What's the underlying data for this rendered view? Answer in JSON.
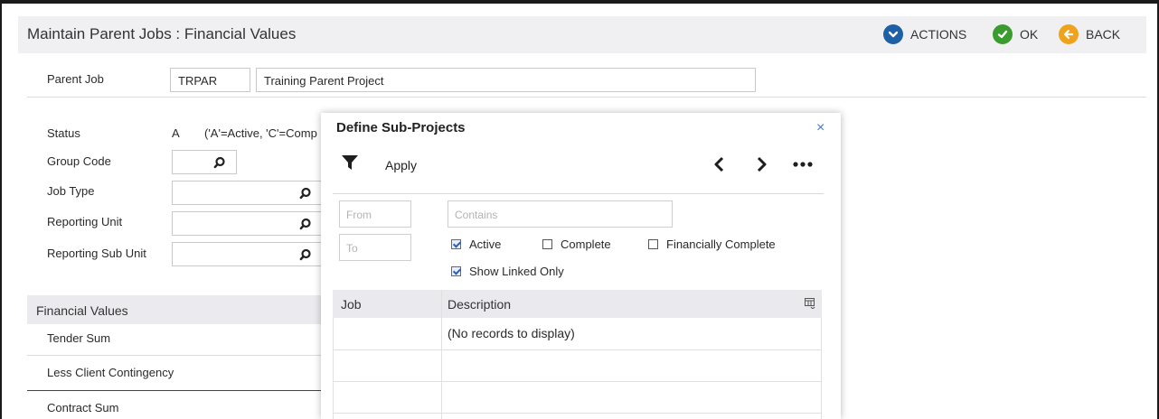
{
  "header": {
    "title": "Maintain Parent Jobs : Financial Values",
    "actions_label": "ACTIONS",
    "ok_label": "OK",
    "back_label": "BACK"
  },
  "colors": {
    "actions": "#1f5fa6",
    "ok": "#3a9b2e",
    "back": "#f0a21c",
    "accent": "#3b7bd4"
  },
  "form": {
    "parent_job_label": "Parent Job",
    "parent_job_code": "TRPAR",
    "parent_job_name": "Training Parent Project",
    "status_label": "Status",
    "status_value": "A",
    "status_hint": "('A'=Active, 'C'=Comp",
    "group_code_label": "Group Code",
    "job_type_label": "Job Type",
    "reporting_unit_label": "Reporting Unit",
    "reporting_sub_unit_label": "Reporting Sub Unit"
  },
  "financial": {
    "section_title": "Financial Values",
    "rows": [
      "Tender Sum",
      "Less Client Contingency",
      "Contract Sum"
    ]
  },
  "modal": {
    "title": "Define Sub-Projects",
    "close": "×",
    "apply_label": "Apply",
    "from_placeholder": "From",
    "to_placeholder": "To",
    "contains_placeholder": "Contains",
    "checkboxes": [
      {
        "label": "Active",
        "checked": true
      },
      {
        "label": "Complete",
        "checked": false
      },
      {
        "label": "Financially Complete",
        "checked": false
      },
      {
        "label": "Show Linked Only",
        "checked": true
      }
    ],
    "grid": {
      "columns": [
        "Job",
        "Description"
      ],
      "empty_message": "(No records to display)"
    }
  },
  "icons": [
    "actions-chevron-icon",
    "ok-check-icon",
    "back-arrow-icon",
    "search-icon",
    "filter-icon",
    "chevron-left-icon",
    "chevron-right-icon",
    "more-icon",
    "column-chooser-icon",
    "close-icon"
  ]
}
